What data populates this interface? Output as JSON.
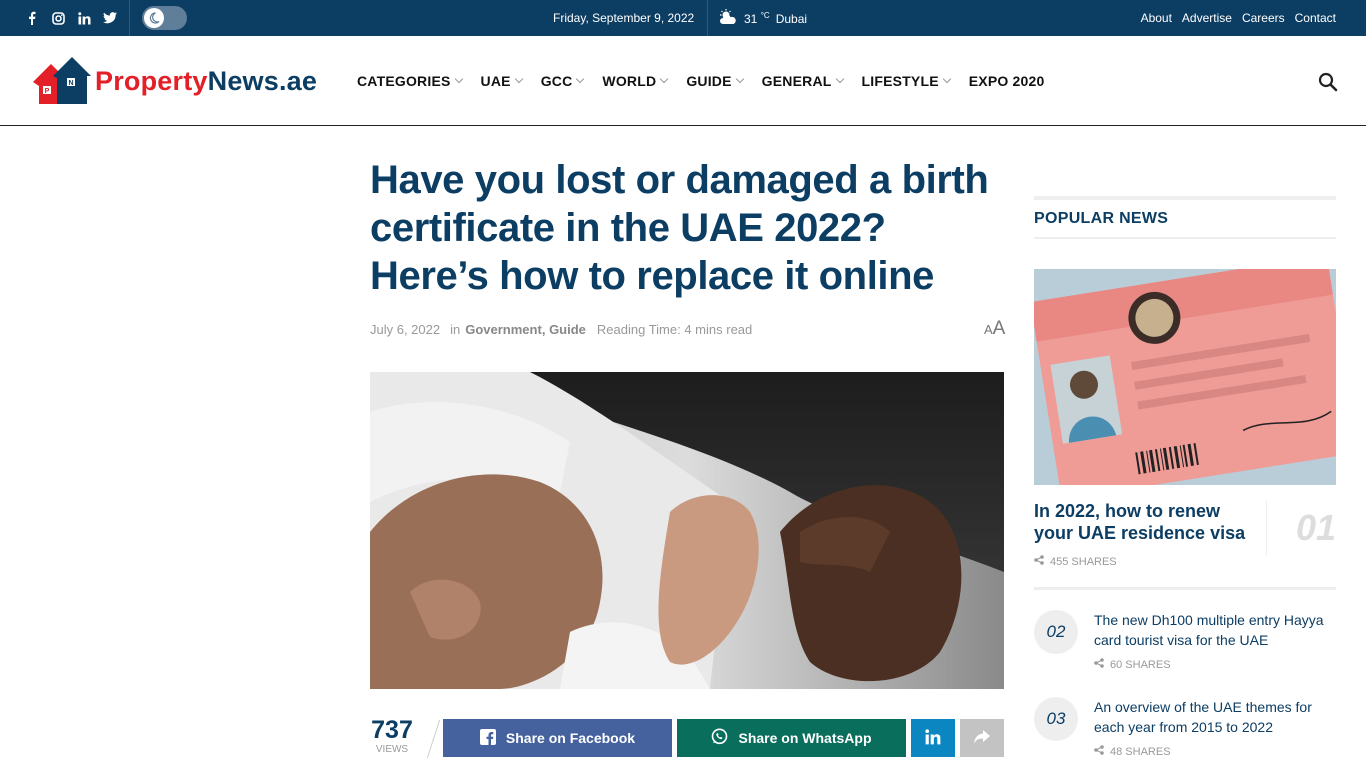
{
  "topbar": {
    "social_icons": [
      "facebook-icon",
      "instagram-icon",
      "linkedin-icon",
      "twitter-icon"
    ],
    "date": "Friday, September 9, 2022",
    "temperature": "31",
    "temp_unit": "°C",
    "city": "Dubai",
    "links": [
      "About",
      "Advertise",
      "Careers",
      "Contact"
    ]
  },
  "header": {
    "logo_part1": "Property",
    "logo_part2": "News.ae",
    "nav": [
      "CATEGORIES",
      "UAE",
      "GCC",
      "WORLD",
      "GUIDE",
      "GENERAL",
      "LIFESTYLE",
      "EXPO 2020"
    ],
    "nav_dropdown": [
      true,
      true,
      true,
      true,
      true,
      true,
      true,
      false
    ]
  },
  "article": {
    "title": "Have you lost or damaged a birth certificate in the UAE 2022? Here’s how to replace it online",
    "date": "July 6, 2022",
    "in_label": "in",
    "category1": "Government",
    "category2": "Guide",
    "reading_time": "Reading Time: 4 mins read",
    "font_small": "A",
    "font_large": "A",
    "views_count": "737",
    "views_label": "VIEWS",
    "share_facebook": "Share on Facebook",
    "share_whatsapp": "Share on WhatsApp"
  },
  "sidebar": {
    "heading": "POPULAR NEWS",
    "items": [
      {
        "num": "01",
        "title": "In 2022, how to renew your UAE residence visa",
        "shares": "455 SHARES"
      },
      {
        "num": "02",
        "title": "The new Dh100 multiple entry Hayya card tourist visa for the UAE",
        "shares": "60 SHARES"
      },
      {
        "num": "03",
        "title": "An overview of the UAE themes for each year from 2015 to 2022",
        "shares": "48 SHARES"
      }
    ]
  },
  "colors": {
    "brand_navy": "#0c3d63",
    "brand_red": "#e32028",
    "facebook": "#45629f",
    "whatsapp": "#0a6e5c",
    "linkedin": "#0b86c1"
  }
}
